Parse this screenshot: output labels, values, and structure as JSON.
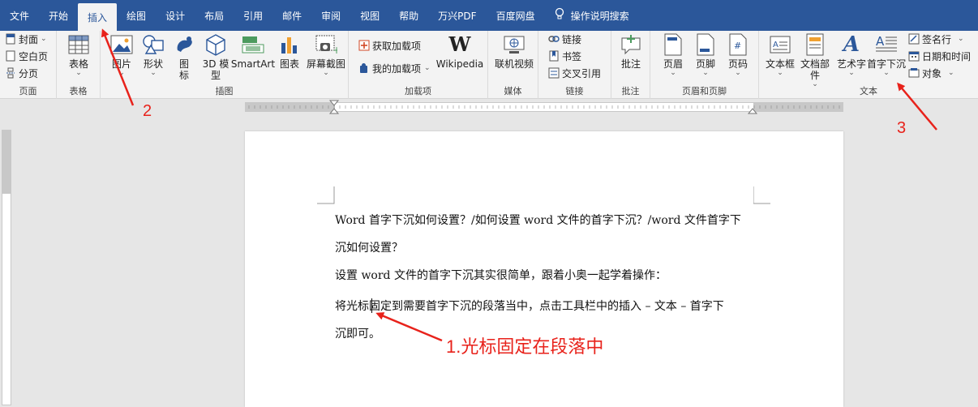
{
  "tabs": [
    {
      "label": "文件"
    },
    {
      "label": "开始"
    },
    {
      "label": "插入",
      "active": true
    },
    {
      "label": "绘图"
    },
    {
      "label": "设计"
    },
    {
      "label": "布局"
    },
    {
      "label": "引用"
    },
    {
      "label": "邮件"
    },
    {
      "label": "审阅"
    },
    {
      "label": "视图"
    },
    {
      "label": "帮助"
    },
    {
      "label": "万兴PDF"
    },
    {
      "label": "百度网盘"
    }
  ],
  "tell_me": "操作说明搜索",
  "ribbon": {
    "pages": {
      "cover": "封面",
      "blank": "空白页",
      "break": "分页",
      "label": "页面"
    },
    "tables": {
      "table": "表格",
      "label": "表格"
    },
    "illustrations": {
      "picture": "图片",
      "shapes": "形状",
      "icons_1": "图",
      "icons_2": "标",
      "model_1": "3D 模",
      "model_2": "型",
      "smartart": "SmartArt",
      "chart": "图表",
      "screenshot": "屏幕截图",
      "label": "插图"
    },
    "addins": {
      "get": "获取加载项",
      "my": "我的加载项",
      "wikipedia": "Wikipedia",
      "label": "加载项"
    },
    "media": {
      "video": "联机视频",
      "label": "媒体"
    },
    "links": {
      "link": "链接",
      "bookmark": "书签",
      "crossref": "交叉引用",
      "label": "链接"
    },
    "comments": {
      "comment": "批注",
      "label": "批注"
    },
    "header_footer": {
      "header": "页眉",
      "footer": "页脚",
      "page_number": "页码",
      "label": "页眉和页脚"
    },
    "text": {
      "textbox": "文本框",
      "quickparts": "文档部件",
      "wordart": "艺术字",
      "dropcap": "首字下沉",
      "signature": "签名行",
      "datetime": "日期和时间",
      "object": "对象",
      "label": "文本"
    }
  },
  "document": {
    "line1": "Word 首字下沉如何设置？/如何设置 word 文件的首字下沉？/word 文件首字下",
    "line2": "沉如何设置？",
    "line3": "设置 word 文件的首字下沉其实很简单，跟着小奥一起学着操作：",
    "line4": "将光标固定到需要首字下沉的段落当中，点击工具栏中的插入 – 文本 – 首字下",
    "line5": "沉即可。"
  },
  "annotations": {
    "step1": "1.光标固定在段落中",
    "step2": "2",
    "step3": "3"
  },
  "colors": {
    "accent": "#2b579a",
    "annotation": "#e8221b"
  }
}
